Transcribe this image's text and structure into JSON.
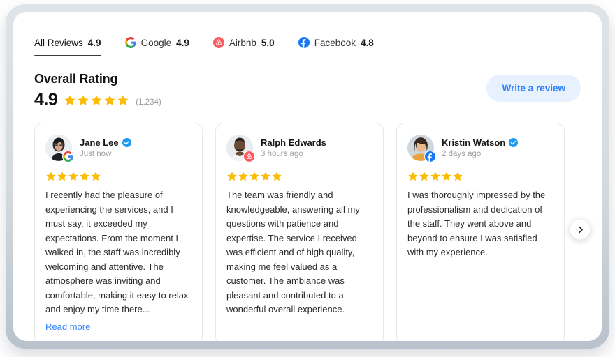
{
  "tabs": [
    {
      "label": "All Reviews",
      "score": "4.9",
      "icon": "none",
      "active": true
    },
    {
      "label": "Google",
      "score": "4.9",
      "icon": "google-icon",
      "active": false
    },
    {
      "label": "Airbnb",
      "score": "5.0",
      "icon": "airbnb-icon",
      "active": false
    },
    {
      "label": "Facebook",
      "score": "4.8",
      "icon": "facebook-icon",
      "active": false
    }
  ],
  "overall": {
    "title": "Overall Rating",
    "value": "4.9",
    "stars": 5,
    "count": "(1,234)"
  },
  "actions": {
    "write_review": "Write a review",
    "next_arrow": "chevron-right-icon"
  },
  "reviews": [
    {
      "name": "Jane Lee",
      "verified": true,
      "time": "Just now",
      "source": "google-icon",
      "stars": 5,
      "text": "I recently had the pleasure of experiencing the services, and I must say, it exceeded my expectations. From the moment I walked in, the staff was incredibly welcoming and attentive. The atmosphere was inviting and comfortable, making it easy to relax and enjoy my time there...",
      "read_more": "Read more"
    },
    {
      "name": "Ralph Edwards",
      "verified": false,
      "time": "3 hours ago",
      "source": "airbnb-icon",
      "stars": 5,
      "text": "The team was friendly and knowledgeable, answering all my questions with patience and expertise. The service I received was efficient and of high quality, making me feel valued as a customer. The ambiance was pleasant and contributed to a wonderful overall experience.",
      "read_more": ""
    },
    {
      "name": "Kristin Watson",
      "verified": true,
      "time": "2 days ago",
      "source": "facebook-icon",
      "stars": 5,
      "text": "I was thoroughly impressed by the professionalism and dedication of the staff. They went above and beyond to ensure I was satisfied with my experience.",
      "read_more": ""
    }
  ],
  "colors": {
    "star": "#FBBC04",
    "accent_blue": "#2f80ff",
    "accent_blue_bg": "#e8f1fe",
    "google_blue": "#4285F4",
    "airbnb_red": "#FF5A5F",
    "facebook_blue": "#1877F2",
    "verified_blue": "#1d9bf0"
  }
}
